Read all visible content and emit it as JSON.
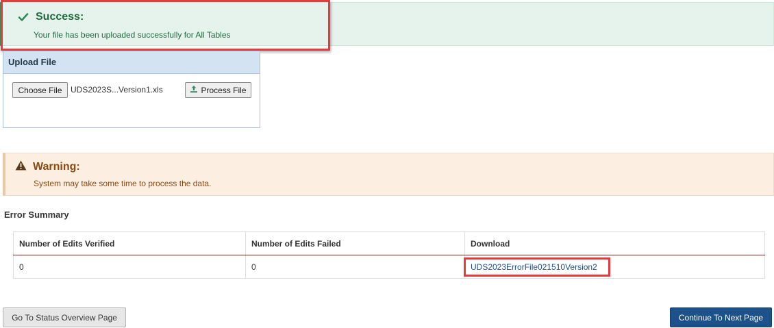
{
  "success": {
    "title": "Success:",
    "message": "Your file has been uploaded successfully for All Tables",
    "icon": "check-icon",
    "color": "#1f6b3f"
  },
  "upload": {
    "header": "Upload File",
    "choose_label": "Choose File",
    "file_name": "UDS2023S...Version1.xls",
    "process_label": "Process File",
    "process_icon": "upload-icon"
  },
  "warning": {
    "title": "Warning:",
    "message": "System may take some time to process the data.",
    "icon": "warning-triangle-icon",
    "color": "#8a4a10"
  },
  "error_summary": {
    "title": "Error Summary",
    "columns": [
      "Number of Edits Verified",
      "Number of Edits Failed",
      "Download"
    ],
    "rows": [
      {
        "verified": "0",
        "failed": "0",
        "download": "UDS2023ErrorFile021510Version2"
      }
    ]
  },
  "footer": {
    "status_label": "Go To Status Overview Page",
    "next_label": "Continue To Next Page"
  },
  "colors": {
    "primary_button": "#1d5189",
    "highlight": "#e8393c",
    "link": "#1f4e8c"
  }
}
